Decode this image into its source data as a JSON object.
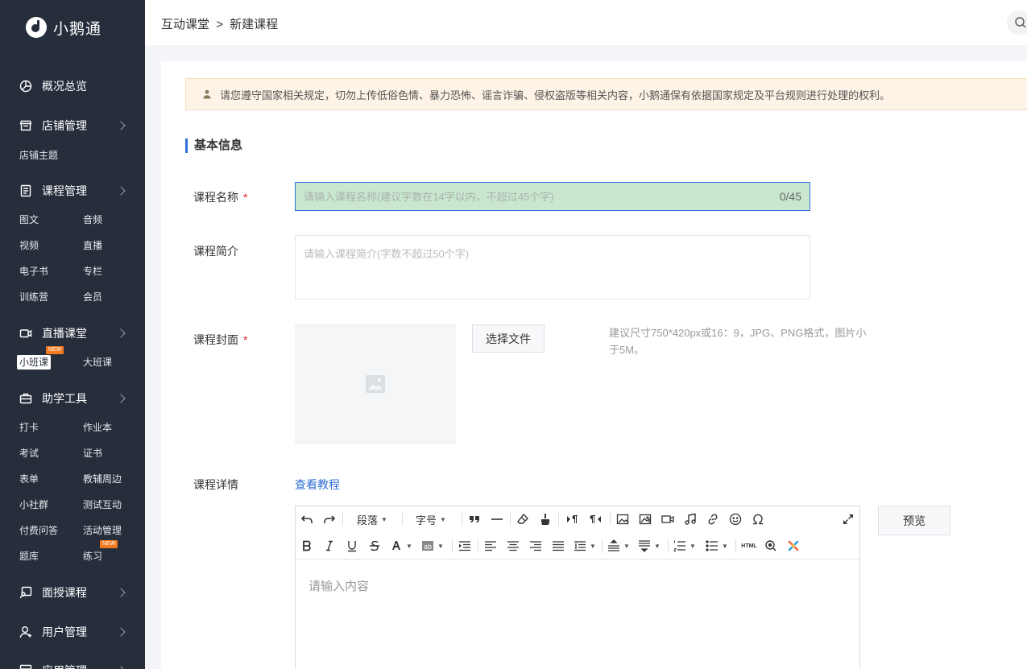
{
  "app": {
    "name": "小鹅通"
  },
  "sidebar": {
    "groups": [
      {
        "label": "概况总览",
        "icon": "pie-chart-icon"
      },
      {
        "label": "店铺管理",
        "icon": "store-icon"
      },
      {
        "label": "课程管理",
        "icon": "document-icon"
      },
      {
        "label": "直播课堂",
        "icon": "video-camera-icon"
      },
      {
        "label": "助学工具",
        "icon": "toolbox-icon"
      },
      {
        "label": "面授课程",
        "icon": "classroom-icon"
      },
      {
        "label": "用户管理",
        "icon": "user-icon"
      },
      {
        "label": "应用管理",
        "icon": "apps-icon"
      }
    ],
    "store_items": [
      "店铺主题"
    ],
    "course_items": [
      "图文",
      "音频",
      "视频",
      "直播",
      "电子书",
      "专栏",
      "训练营",
      "会员"
    ],
    "live_items": [
      "小班课",
      "大班课"
    ],
    "tool_items": [
      "打卡",
      "作业本",
      "考试",
      "证书",
      "表单",
      "教辅周边",
      "小社群",
      "测试互动",
      "付费问答",
      "活动管理",
      "题库",
      "练习"
    ],
    "new_badge": "NEW"
  },
  "header": {
    "breadcrumb": [
      "互动课堂",
      ">",
      "新建课程"
    ]
  },
  "notice": {
    "text": "请您遵守国家相关规定，切勿上传低俗色情、暴力恐怖、谣言诈骗、侵权盗版等相关内容，小鹅通保有依据国家规定及平台规则进行处理的权利。"
  },
  "form": {
    "section_title": "基本信息",
    "name_label": "课程名称",
    "required_mark": "*",
    "name_placeholder": "请输入课程名称(建议字数在14字以内，不超过45个字)",
    "name_value": "",
    "name_counter": "0/45",
    "intro_label": "课程简介",
    "intro_placeholder": "请输入课程简介(字数不超过50个字)",
    "cover_label": "课程封面",
    "file_button": "选择文件",
    "cover_hint": "建议尺寸750*420px或16：9，JPG、PNG格式，图片小于5M。",
    "detail_label": "课程详情",
    "tutorial_link": "查看教程",
    "editor_placeholder": "请输入内容",
    "preview_button": "预览",
    "toolbar": {
      "paragraph": "段落",
      "font_size": "字号",
      "html": "HTML"
    }
  },
  "colors": {
    "sidebar_bg": "#262e3c",
    "accent": "#2f6fd6",
    "input_fill": "#c9e6cf",
    "badge": "#f47a20",
    "required": "#e02020"
  }
}
